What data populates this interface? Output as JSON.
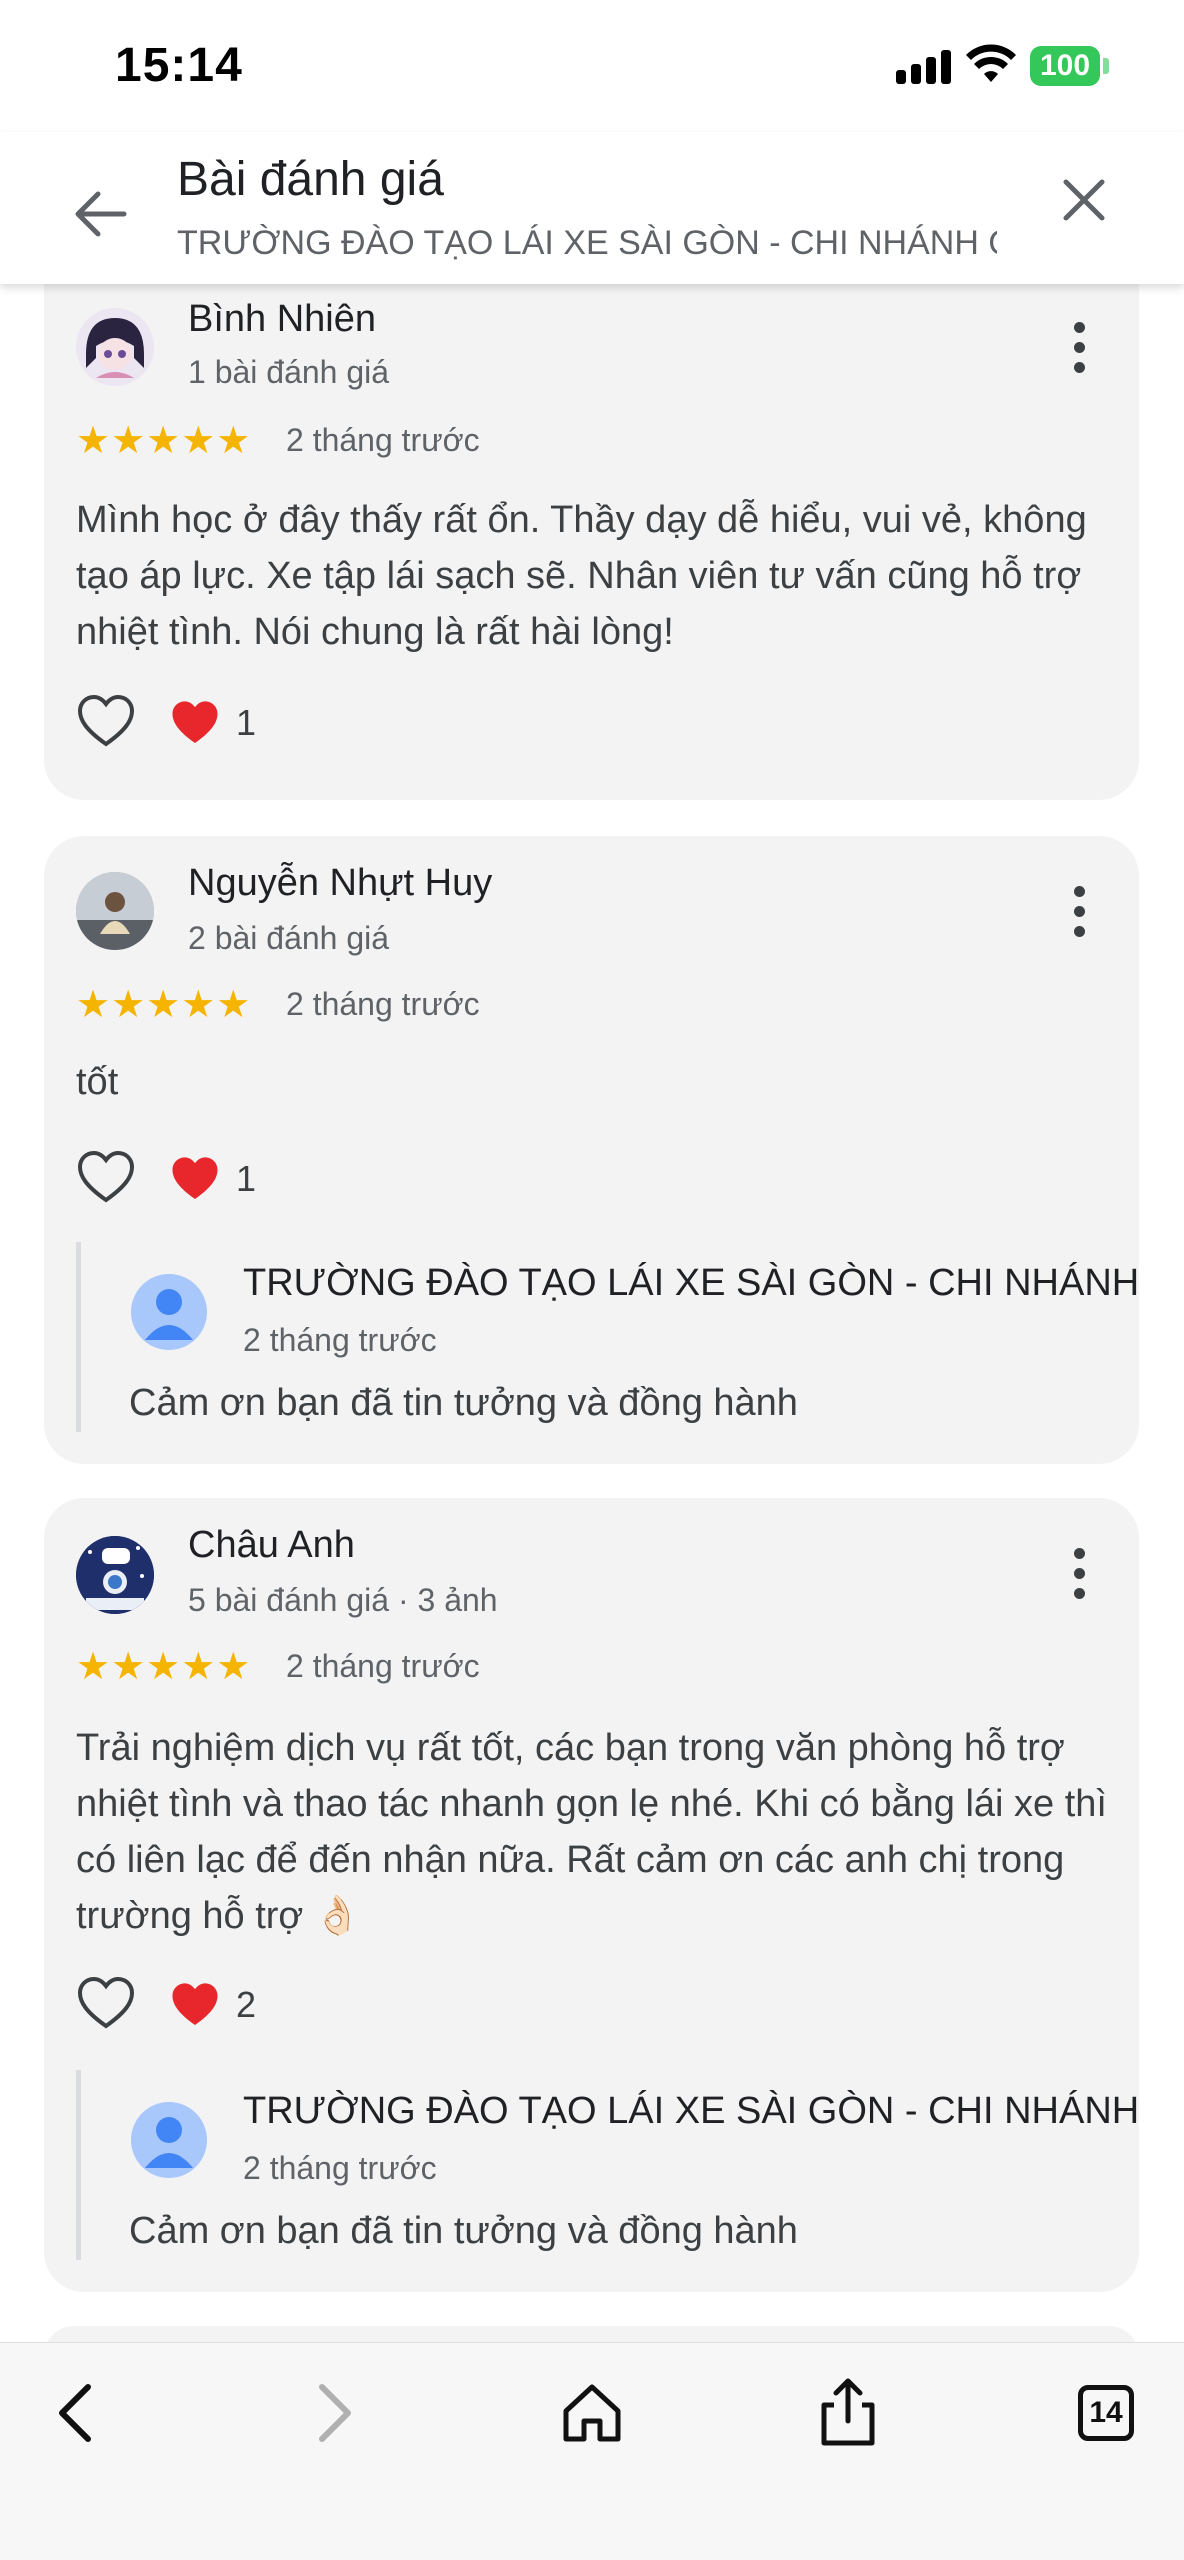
{
  "status_bar": {
    "time": "15:14",
    "battery": "100"
  },
  "header": {
    "title": "Bài đánh giá",
    "subtitle": "TRƯỜNG ĐÀO TẠO LÁI XE SÀI GÒN - CHI NHÁNH QU"
  },
  "reviews": [
    {
      "name": "Bình Nhiên",
      "meta": "1 bài đánh giá",
      "rating": 5,
      "stars": "★★★★★",
      "date": "2 tháng trước",
      "text": "Mình học ở đây thấy rất ổn. Thầy dạy dễ hiểu, vui vẻ, không tạo áp lực. Xe tập lái sạch sẽ. Nhân viên tư vấn cũng hỗ trợ nhiệt tình. Nói chung là rất hài lòng!",
      "reactions": "1"
    },
    {
      "name": "Nguyễn Nhựt Huy",
      "meta": "2 bài đánh giá",
      "rating": 5,
      "stars": "★★★★★",
      "date": "2 tháng trước",
      "text": "tốt",
      "reactions": "1",
      "reply": {
        "name": "TRƯỜNG ĐÀO TẠO LÁI XE SÀI GÒN - CHI NHÁNH QU",
        "date": "2 tháng trước",
        "text": "Cảm ơn bạn đã tin tưởng và đồng hành"
      }
    },
    {
      "name": "Châu Anh",
      "meta": "5 bài đánh giá · 3 ảnh",
      "rating": 5,
      "stars": "★★★★★",
      "date": "2 tháng trước",
      "text": "Trải nghiệm dịch vụ rất tốt, các bạn trong văn phòng hỗ trợ nhiệt tình và thao tác nhanh gọn lẹ nhé. Khi có bằng lái xe thì có liên lạc để đến nhận nữa. Rất cảm ơn các anh chị trong trường hỗ trợ 👌🏻",
      "reactions": "2",
      "reply": {
        "name": "TRƯỜNG ĐÀO TẠO LÁI XE SÀI GÒN - CHI NHÁNH QU",
        "date": "2 tháng trước",
        "text": "Cảm ơn bạn đã tin tưởng và đồng hành"
      }
    }
  ],
  "toolbar": {
    "tabs_count": "14"
  },
  "colors": {
    "star": "#f5b400",
    "heart": "#e8272d",
    "battery": "#34c759",
    "card": "#f3f3f3"
  },
  "icons": [
    "back-arrow-icon",
    "close-icon",
    "more-vert-icon",
    "heart-outline-icon",
    "heart-red-icon",
    "person-icon",
    "chevron-left-icon",
    "chevron-right-icon",
    "home-icon",
    "share-icon",
    "tabs-icon"
  ]
}
